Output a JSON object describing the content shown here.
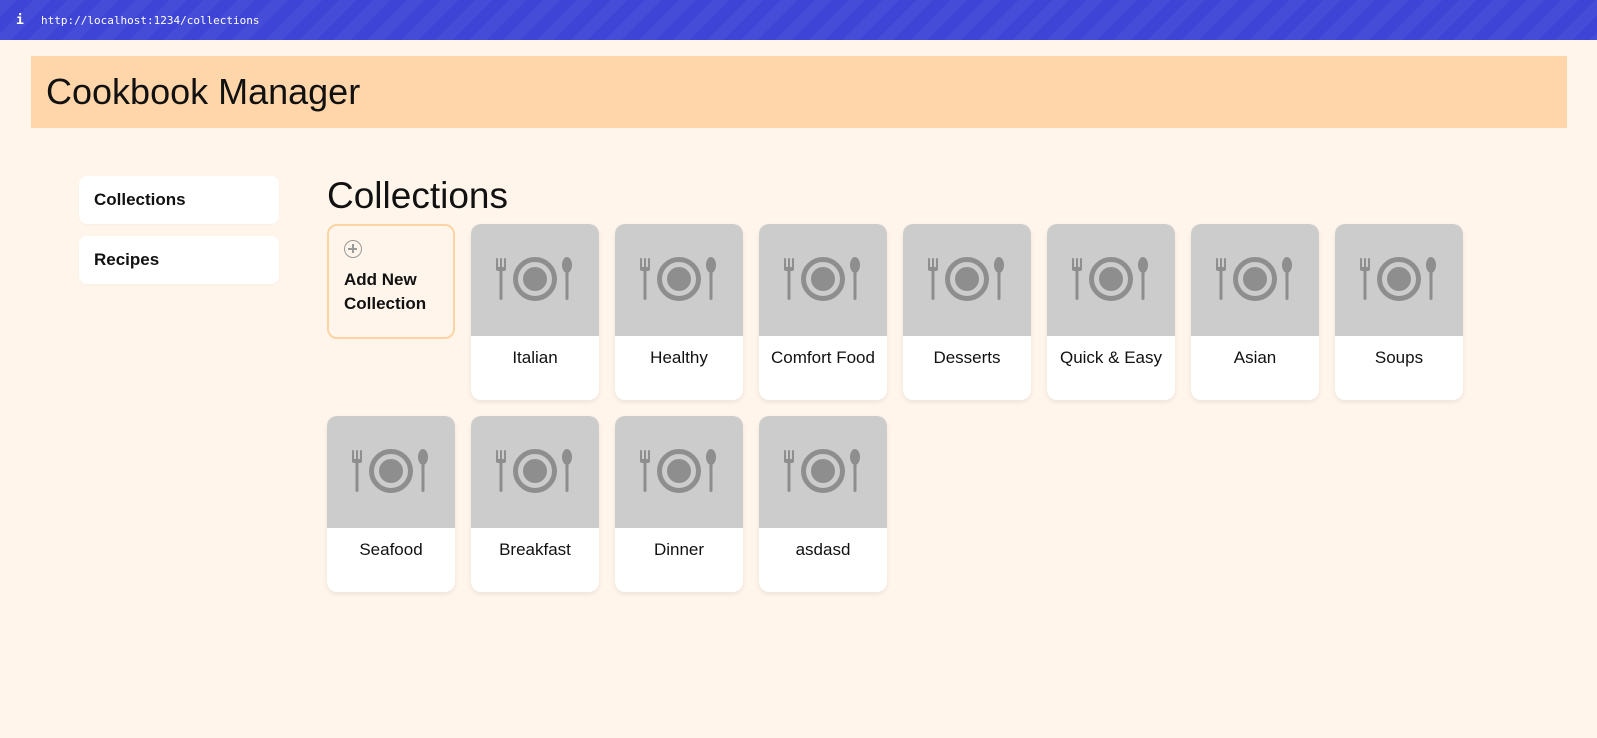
{
  "browser": {
    "info_icon": "i",
    "url": "http://localhost:1234/collections"
  },
  "header": {
    "title": "Cookbook Manager"
  },
  "sidebar": {
    "items": [
      {
        "label": "Collections"
      },
      {
        "label": "Recipes"
      }
    ]
  },
  "main": {
    "title": "Collections",
    "add_card": {
      "icon": "plus-circle-icon",
      "label": "Add New Collection"
    },
    "collections": [
      {
        "name": "Italian",
        "icon": "fork-plate-spoon-icon"
      },
      {
        "name": "Healthy",
        "icon": "fork-plate-spoon-icon"
      },
      {
        "name": "Comfort Food",
        "icon": "fork-plate-spoon-icon"
      },
      {
        "name": "Desserts",
        "icon": "fork-plate-spoon-icon"
      },
      {
        "name": "Quick & Easy",
        "icon": "fork-plate-spoon-icon"
      },
      {
        "name": "Asian",
        "icon": "fork-plate-spoon-icon"
      },
      {
        "name": "Soups",
        "icon": "fork-plate-spoon-icon"
      },
      {
        "name": "Seafood",
        "icon": "fork-plate-spoon-icon"
      },
      {
        "name": "Breakfast",
        "icon": "fork-plate-spoon-icon"
      },
      {
        "name": "Dinner",
        "icon": "fork-plate-spoon-icon"
      },
      {
        "name": "asdasd",
        "icon": "fork-plate-spoon-icon"
      }
    ]
  },
  "colors": {
    "browser_bar": "#3d44d6",
    "header_bg": "#fed6aa",
    "page_bg": "#fff5eb",
    "placeholder_bg": "#cccccc",
    "icon_gray": "#8e8e8e",
    "add_card_border": "#fed3a4"
  }
}
